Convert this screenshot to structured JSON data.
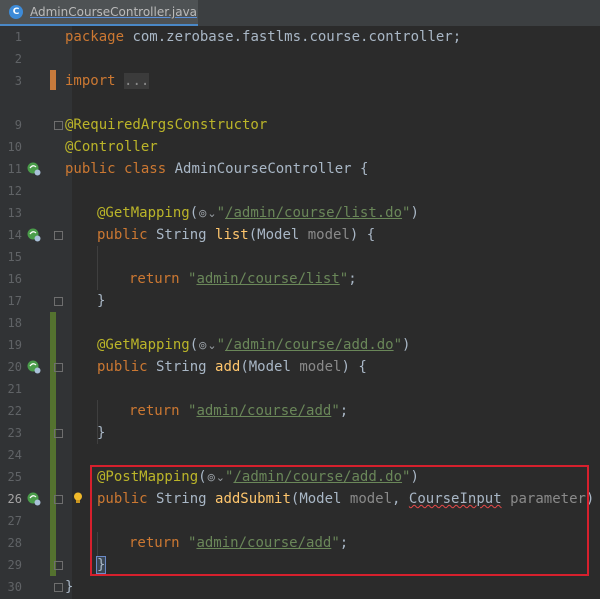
{
  "tab": {
    "filename": "AdminCourseController.java",
    "icon": "java-class-icon"
  },
  "line_numbers": [
    "1",
    "2",
    "3",
    "9",
    "10",
    "11",
    "12",
    "13",
    "14",
    "15",
    "16",
    "17",
    "18",
    "19",
    "20",
    "21",
    "22",
    "23",
    "24",
    "25",
    "26",
    "27",
    "28",
    "29",
    "30"
  ],
  "code": {
    "package_kw": "package",
    "package_name": " com.zerobase.fastlms.course.controller;",
    "import_kw": "import",
    "import_fold": "...",
    "ann_required": "@RequiredArgsConstructor",
    "ann_controller": "@Controller",
    "class_public": "public",
    "class_kw": "class",
    "class_name": " AdminCourseController {",
    "get_list_ann": "@GetMapping",
    "get_list_url": "/admin/course/list.do",
    "list_sig_public": "public",
    "list_sig_type": " String ",
    "list_sig_name": "list",
    "list_sig_model": "(Model ",
    "list_sig_param": "model",
    "list_sig_end": ") {",
    "return_kw": "return",
    "list_return": "admin/course/list",
    "get_add_ann": "@GetMapping",
    "get_add_url": "/admin/course/add.do",
    "add_sig_name": "add",
    "add_return": "admin/course/add",
    "post_add_ann": "@PostMapping",
    "post_add_url": "/admin/course/add.do",
    "submit_sig_name": "addSubmit",
    "submit_type1": "Model ",
    "submit_param1": "model",
    "submit_type2": "CourseInput",
    "submit_param2": "parameter",
    "submit_return": "admin/course/add",
    "close_brace": "}"
  },
  "colors": {
    "background": "#2b2b2b",
    "keyword": "#cc7832",
    "annotation": "#bbb529",
    "string": "#6a8759",
    "method": "#ffc66d",
    "highlight_box": "#d6202d"
  }
}
